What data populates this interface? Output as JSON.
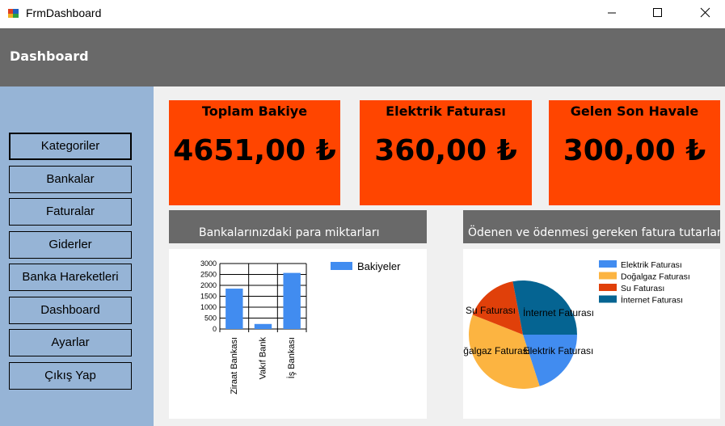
{
  "window": {
    "title": "FrmDashboard"
  },
  "header": {
    "title": "Dashboard"
  },
  "sidebar": {
    "items": [
      {
        "label": "Kategoriler",
        "active": true
      },
      {
        "label": "Bankalar"
      },
      {
        "label": "Faturalar"
      },
      {
        "label": "Giderler"
      },
      {
        "label": "Banka Hareketleri"
      },
      {
        "label": "Dashboard"
      },
      {
        "label": "Ayarlar"
      },
      {
        "label": "Çıkış Yap"
      }
    ]
  },
  "cards": [
    {
      "title": "Toplam Bakiye",
      "value": "4651,00 ₺"
    },
    {
      "title": "Elektrik Faturası",
      "value": "360,00 ₺"
    },
    {
      "title": "Gelen Son Havale",
      "value": "300,00 ₺"
    }
  ],
  "panels": {
    "bank_title": "Bankalarınızdaki para miktarları",
    "bill_title": "Ödenen ve ödenmesi gereken fatura tutarları"
  },
  "colors": {
    "card": "#ff4500",
    "header": "#696969",
    "sidebar": "#96b4d6"
  },
  "chart_data": [
    {
      "type": "bar",
      "categories": [
        "Ziraat Bankası",
        "Vakıf Bank",
        "İş Bankası"
      ],
      "series": [
        {
          "name": "Bakiyeler",
          "values": [
            1850,
            230,
            2570
          ],
          "color": "#418cf0"
        }
      ],
      "yticks": [
        "3000",
        "2500",
        "2000",
        "1500",
        "1000",
        "500",
        "0"
      ],
      "ylim": [
        0,
        3000
      ],
      "grid": true,
      "legend": "top-right"
    },
    {
      "type": "pie",
      "slices": [
        {
          "label": "Elektrik Faturası",
          "value": 0.2,
          "color": "#418cf0"
        },
        {
          "label": "Doğalgaz Faturası",
          "value": 0.36,
          "color": "#fcb441"
        },
        {
          "label": "Su Faturası",
          "value": 0.16,
          "color": "#e0400a"
        },
        {
          "label": "İnternet Faturası",
          "value": 0.28,
          "color": "#056492"
        }
      ],
      "legend": "top-right"
    }
  ]
}
